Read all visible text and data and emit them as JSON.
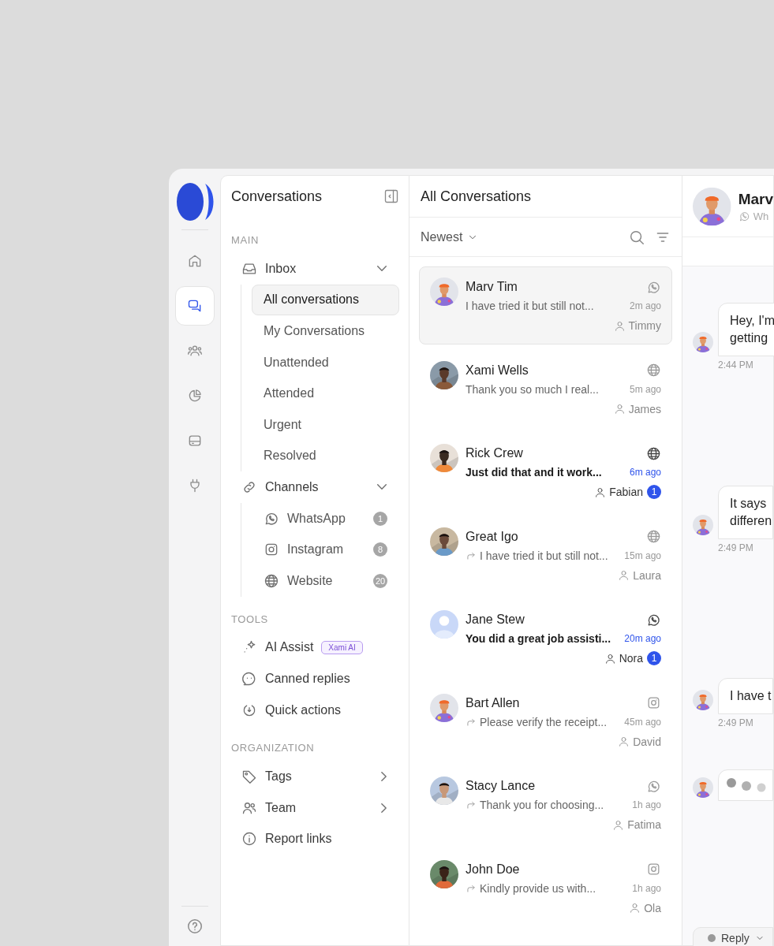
{
  "rail": {
    "items": [
      {
        "selected": false
      },
      {
        "selected": true
      },
      {
        "selected": false
      },
      {
        "selected": false
      },
      {
        "selected": false
      },
      {
        "selected": false
      }
    ]
  },
  "nav": {
    "title": "Conversations",
    "sections": [
      {
        "label": "MAIN",
        "items": [
          {
            "label": "Inbox",
            "expanded": true,
            "children": [
              {
                "label": "All conversations",
                "selected": true
              },
              {
                "label": "My Conversations",
                "selected": false
              },
              {
                "label": "Unattended",
                "selected": false
              },
              {
                "label": "Attended",
                "selected": false
              },
              {
                "label": "Urgent",
                "selected": false
              },
              {
                "label": "Resolved",
                "selected": false
              }
            ]
          },
          {
            "label": "Channels",
            "expanded": true,
            "children": [
              {
                "label": "WhatsApp",
                "count": "1",
                "selected": false
              },
              {
                "label": "Instagram",
                "count": "8",
                "selected": false
              },
              {
                "label": "Website",
                "count": "20",
                "selected": false
              }
            ]
          }
        ]
      },
      {
        "label": "TOOLS",
        "items": [
          {
            "label": "AI Assist",
            "badge": "Xami AI"
          },
          {
            "label": "Canned replies"
          },
          {
            "label": "Quick actions"
          }
        ]
      },
      {
        "label": "ORGANIZATION",
        "items": [
          {
            "label": "Tags",
            "expanded": false
          },
          {
            "label": "Team",
            "expanded": false
          },
          {
            "label": "Report links"
          }
        ]
      }
    ]
  },
  "list": {
    "title": "All Conversations",
    "sort": "Newest",
    "conversations": [
      {
        "name": "Marv Tim",
        "preview": "I have tried it but still not...",
        "time": "2m ago",
        "agent": "Timmy",
        "kind": "whatsapp",
        "forwarded": false,
        "unread": false,
        "selected": true
      },
      {
        "name": "Xami Wells",
        "preview": "Thank you so much I real...",
        "time": "5m ago",
        "agent": "James",
        "kind": "web",
        "forwarded": false,
        "unread": false,
        "selected": false
      },
      {
        "name": "Rick Crew",
        "preview": "Just did that and it work...",
        "time": "6m ago",
        "agent": "Fabian",
        "badge": "1",
        "kind": "web",
        "forwarded": false,
        "unread": true,
        "selected": false
      },
      {
        "name": "Great Igo",
        "preview": "I have tried it but still not...",
        "time": "15m ago",
        "agent": "Laura",
        "kind": "web",
        "forwarded": true,
        "unread": false,
        "selected": false
      },
      {
        "name": "Jane Stew",
        "preview": "You did a great job assisti...",
        "time": "20m ago",
        "agent": "Nora",
        "badge": "1",
        "kind": "whatsapp",
        "avatar": {
          "kind": "placeholder"
        },
        "forwarded": false,
        "unread": true,
        "selected": false
      },
      {
        "name": "Bart Allen",
        "preview": "Please verify the receipt...",
        "time": "45m ago",
        "agent": "David",
        "kind": "instagram",
        "forwarded": true,
        "unread": false,
        "selected": false
      },
      {
        "name": "Stacy Lance",
        "preview": "Thank you for choosing...",
        "time": "1h ago",
        "agent": "Fatima",
        "kind": "whatsapp",
        "forwarded": true,
        "unread": false,
        "selected": false
      },
      {
        "name": "John Doe",
        "preview": "Kindly provide us with...",
        "time": "1h ago",
        "agent": "Ola",
        "kind": "instagram",
        "forwarded": true,
        "unread": false,
        "selected": false
      }
    ]
  },
  "chat": {
    "name": "Marv",
    "channel": "Wh",
    "messages": [
      {
        "kind": "text",
        "lines": [
          "Hey, I'm",
          "getting"
        ],
        "time": "2:44 PM"
      },
      {
        "kind": "text",
        "lines": [
          "It says",
          "differen"
        ],
        "time": "2:49 PM"
      },
      {
        "kind": "text",
        "lines": [
          "I have t"
        ],
        "time": "2:49 PM"
      },
      {
        "kind": "typing"
      }
    ],
    "reply": "Reply"
  }
}
